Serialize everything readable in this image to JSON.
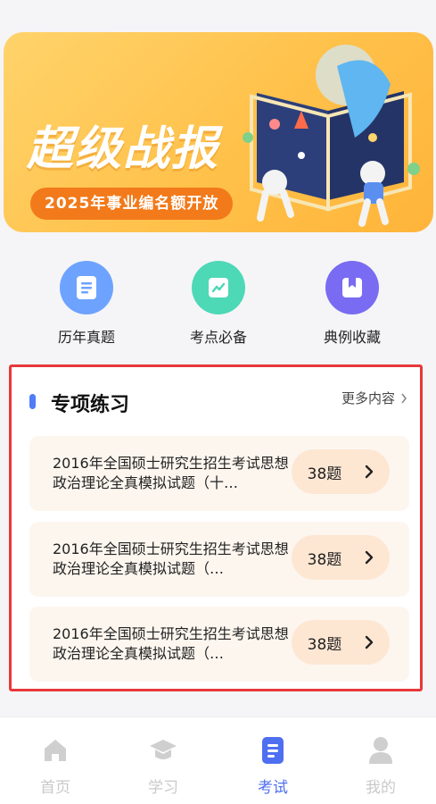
{
  "banner": {
    "title": "超级战报",
    "pill": "2025年事业编名额开放"
  },
  "quick_links": [
    {
      "label": "历年真题",
      "icon": "document-icon",
      "color": "#6da3ff"
    },
    {
      "label": "考点必备",
      "icon": "chart-icon",
      "color": "#4dd8b6"
    },
    {
      "label": "典例收藏",
      "icon": "bookmark-icon",
      "color": "#7a6bf3"
    }
  ],
  "section": {
    "title": "专项练习",
    "more": "更多内容",
    "items": [
      {
        "title": "2016年全国硕士研究生招生考试思想政治理论全真模拟试题（十…",
        "count": "38题"
      },
      {
        "title": "2016年全国硕士研究生招生考试思想政治理论全真模拟试题（…",
        "count": "38题"
      },
      {
        "title": "2016年全国硕士研究生招生考试思想政治理论全真模拟试题（…",
        "count": "38题"
      }
    ]
  },
  "tabs": [
    {
      "label": "首页",
      "icon": "home-icon",
      "active": false
    },
    {
      "label": "学习",
      "icon": "graduation-cap-icon",
      "active": false
    },
    {
      "label": "考试",
      "icon": "exam-paper-icon",
      "active": true
    },
    {
      "label": "我的",
      "icon": "user-icon",
      "active": false
    }
  ],
  "colors": {
    "accent": "#4f6ff1",
    "highlight_border": "#e8383a",
    "card_bg": "#fdf6ef",
    "pill": "#f27a1a"
  }
}
